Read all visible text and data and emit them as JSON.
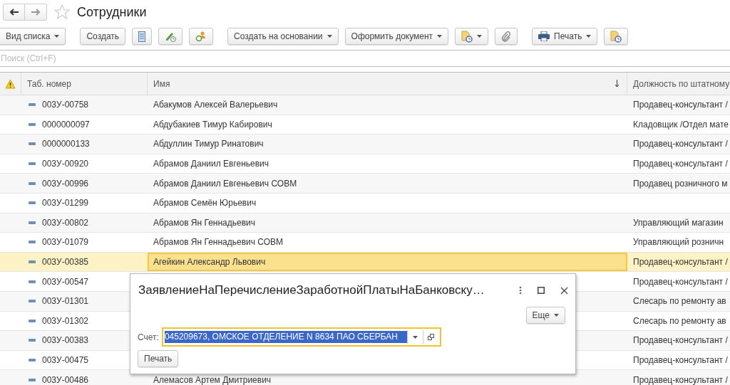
{
  "window": {
    "title": "Сотрудники",
    "favorite": false
  },
  "toolbar": [
    {
      "kind": "text",
      "label": "Вид списка",
      "dropdown": true
    },
    {
      "kind": "text",
      "label": "Создать",
      "dropdown": false
    },
    {
      "kind": "icon",
      "dropdown": false
    },
    {
      "kind": "icon",
      "dropdown": false
    },
    {
      "kind": "icon",
      "dropdown": false
    },
    {
      "kind": "text",
      "label": "Создать на основании",
      "dropdown": true
    },
    {
      "kind": "text",
      "label": "Оформить документ",
      "dropdown": true
    },
    {
      "kind": "icon",
      "dropdown": true
    },
    {
      "kind": "icon",
      "dropdown": false
    },
    {
      "kind": "icon-text",
      "label": "Печать",
      "dropdown": true
    },
    {
      "kind": "icon",
      "dropdown": false
    }
  ],
  "search": {
    "placeholder": "Поиск (Ctrl+F)"
  },
  "table": {
    "columns": [
      {
        "label": "Таб. номер"
      },
      {
        "label": "Имя",
        "sorted": true
      },
      {
        "label": "Должность по штатному"
      }
    ],
    "rows": [
      {
        "number": "003У-00758",
        "name": "Абакумов Алексей Валерьевич",
        "position": "Продавец-консультант /",
        "selected": false
      },
      {
        "number": "0000000097",
        "name": "Абдубакиев Тимур Кабирович",
        "position": "Кладовщик /Отдел мате",
        "selected": false
      },
      {
        "number": "0000000133",
        "name": "Абдуллин Тимур Ринатович",
        "position": "Продавец-консультант /",
        "selected": false
      },
      {
        "number": "003У-00920",
        "name": "Абрамов Даниил Евгеньевич",
        "position": "Продавец-консультант /",
        "selected": false
      },
      {
        "number": "003У-00996",
        "name": "Абрамов Даниил Евгеньевич СОВМ",
        "position": "Продавец розничного м",
        "selected": false
      },
      {
        "number": "003У-01299",
        "name": "Абрамов Семён Юрьевич",
        "selected": false
      },
      {
        "number": "003У-00802",
        "name": "Абрамов Ян Геннадьевич",
        "position": "Управляющий магазин",
        "selected": false
      },
      {
        "number": "003У-01079",
        "name": "Абрамов Ян Геннадьевич СОВМ",
        "position": "Управляющий розничн",
        "selected": false
      },
      {
        "number": "003У-00385",
        "name": "Агейкин Александр Львович",
        "position": "Продавец-консультант /",
        "selected": true
      },
      {
        "number": "003У-00547",
        "position": "Продавец-консультант /",
        "selected": false
      },
      {
        "number": "003У-01301",
        "position": "Слесарь по ремонту ав",
        "selected": false
      },
      {
        "number": "003У-01302",
        "position": "Слесарь по ремонту ав",
        "selected": false
      },
      {
        "number": "003У-00383",
        "position": "Продавец-консультант /",
        "selected": false
      },
      {
        "number": "003У-00475",
        "position": "Продавец-консультант /",
        "selected": false
      },
      {
        "number": "003У-00486",
        "name": "Алемасов Артем Дмитриевич",
        "position": "Продавец-консультант /",
        "selected": false
      }
    ]
  },
  "dialog": {
    "title": "ЗаявлениеНаПеречислениеЗаработнойПлатыНаБанковску…",
    "more_button": "Еще",
    "field_label": "Счет:",
    "field_value": "045209673, ОМСКОЕ ОТДЕЛЕНИЕ N 8634 ПАО СБЕРБАН",
    "print_button": "Печать"
  }
}
